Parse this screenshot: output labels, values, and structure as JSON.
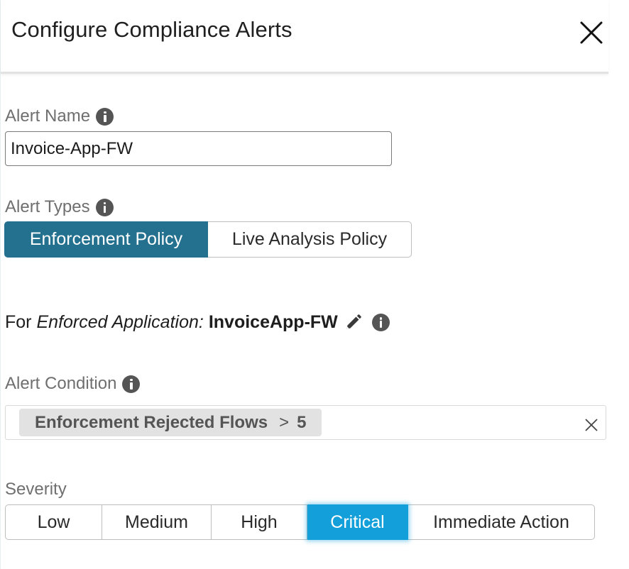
{
  "dialog": {
    "title": "Configure Compliance Alerts",
    "close_icon": "close-icon"
  },
  "alert_name": {
    "label": "Alert Name",
    "info_icon": "info-icon",
    "value": "Invoice-App-FW"
  },
  "alert_types": {
    "label": "Alert Types",
    "info_icon": "info-icon",
    "options": [
      "Enforcement Policy",
      "Live Analysis Policy"
    ],
    "selected": "Enforcement Policy",
    "active_color": "#23708f"
  },
  "enforced_application": {
    "prefix": "For",
    "kind": "Enforced Application:",
    "name": "InvoiceApp-FW",
    "edit_icon": "pencil-icon",
    "info_icon": "info-icon"
  },
  "alert_condition": {
    "label": "Alert Condition",
    "info_icon": "info-icon",
    "chip": {
      "metric": "Enforcement Rejected Flows",
      "operator": ">",
      "value": "5"
    },
    "clear_icon": "close-icon"
  },
  "severity": {
    "label": "Severity",
    "options": [
      "Low",
      "Medium",
      "High",
      "Critical",
      "Immediate Action"
    ],
    "selected": "Critical",
    "active_color": "#139fd9"
  }
}
